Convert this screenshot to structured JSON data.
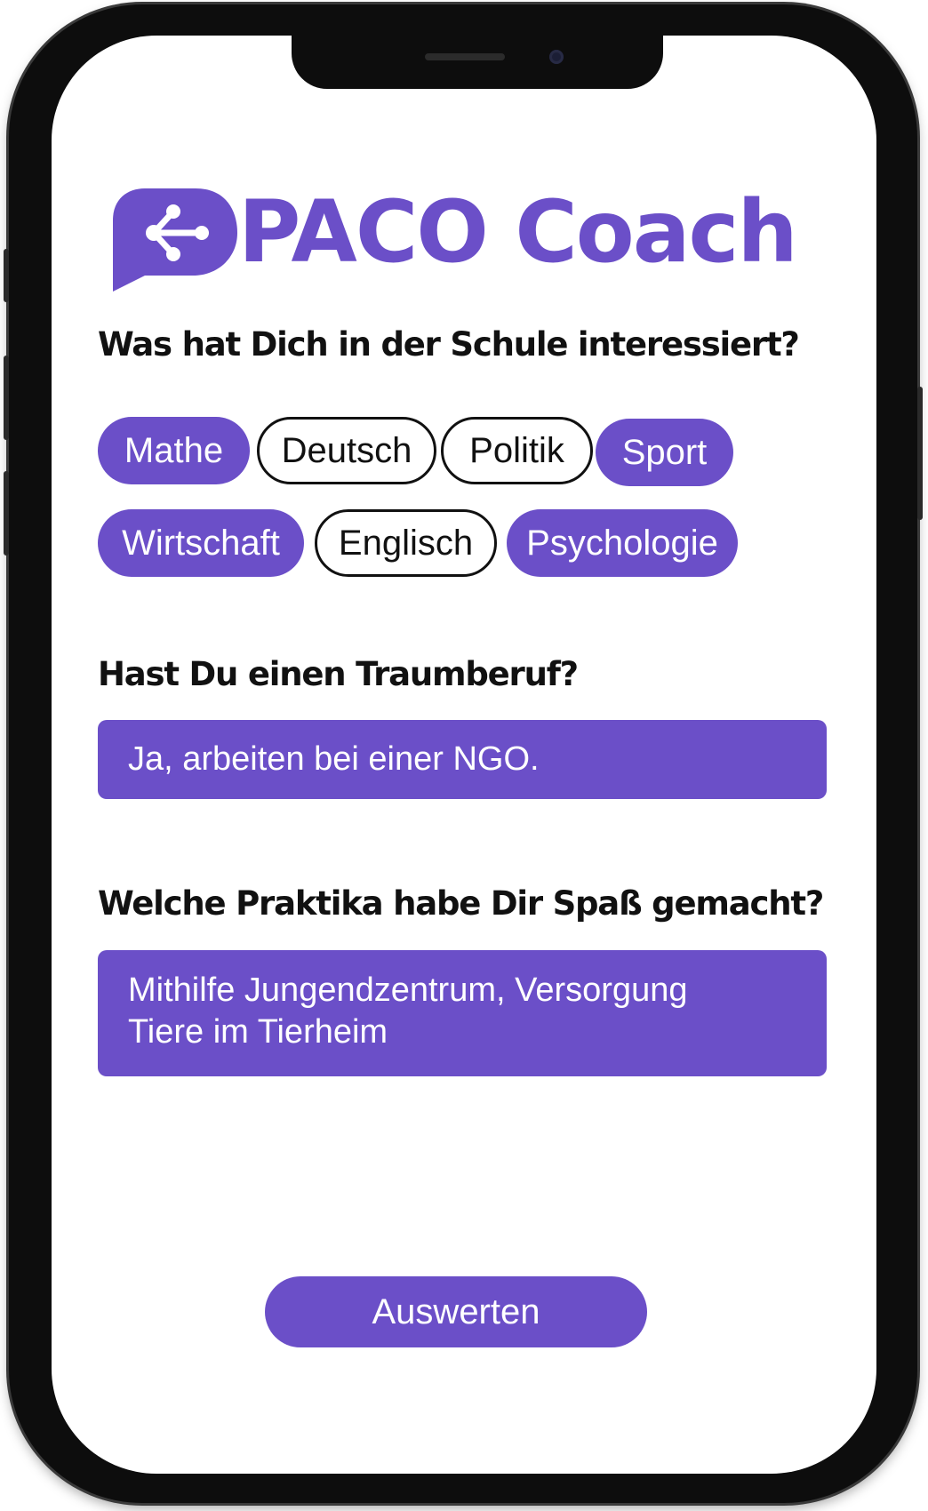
{
  "app": {
    "brand_name": "PACO Coach",
    "logo_icon": "share-nodes-chat-bubble-icon",
    "accent_color": "#6b4fc8"
  },
  "questions": [
    {
      "label": "Was hat Dich in der Schule interessiert?",
      "options": [
        {
          "label": "Mathe",
          "selected": true
        },
        {
          "label": "Deutsch",
          "selected": false
        },
        {
          "label": "Politik",
          "selected": false
        },
        {
          "label": "Sport",
          "selected": true
        },
        {
          "label": "Wirtschaft",
          "selected": true
        },
        {
          "label": "Englisch",
          "selected": false
        },
        {
          "label": "Psychologie",
          "selected": true
        }
      ]
    },
    {
      "label": "Hast Du einen Traumberuf?",
      "answer": "Ja, arbeiten bei einer NGO."
    },
    {
      "label": "Welche Praktika habe Dir Spaß gemacht?",
      "answer_lines": [
        "Mithilfe Jungendzentrum, Versorgung",
        "Tiere im Tierheim"
      ]
    }
  ],
  "actions": {
    "submit_label": "Auswerten"
  }
}
